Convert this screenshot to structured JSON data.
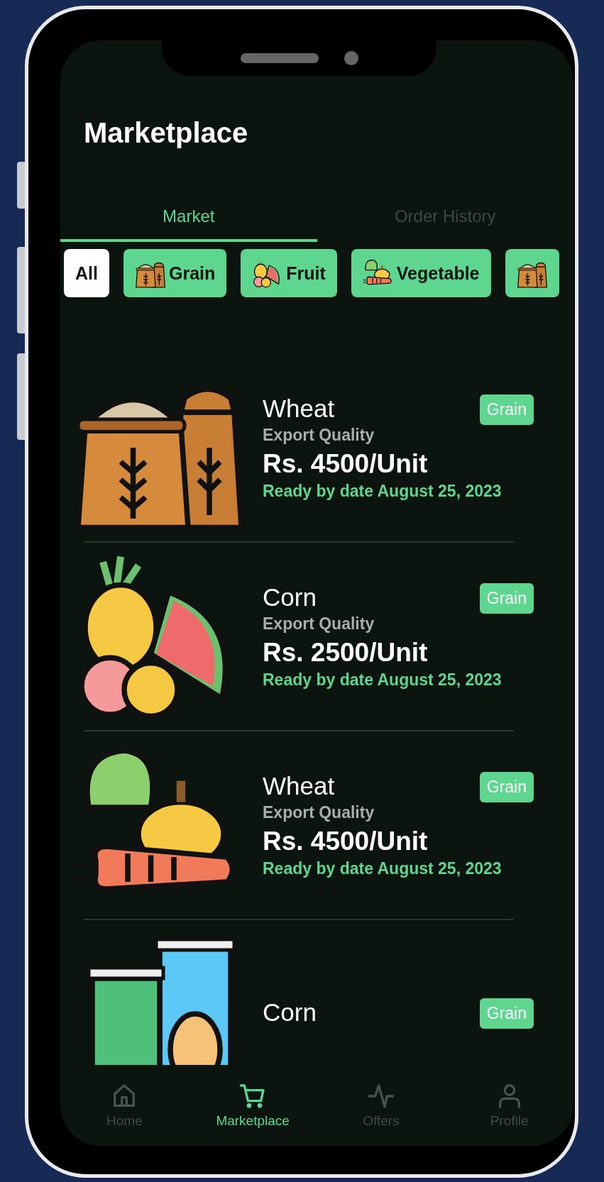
{
  "header": {
    "title": "Marketplace"
  },
  "tabs": [
    {
      "label": "Market",
      "selected": true
    },
    {
      "label": "Order History",
      "selected": false
    }
  ],
  "filters": [
    {
      "label": "All",
      "kind": "plain",
      "selected": true
    },
    {
      "label": "Grain",
      "kind": "grain",
      "selected": false
    },
    {
      "label": "Fruit",
      "kind": "fruit",
      "selected": false
    },
    {
      "label": "Vegetable",
      "kind": "vegetable",
      "selected": false
    },
    {
      "kind": "grain",
      "selected": false
    }
  ],
  "listings": [
    {
      "kind": "grain",
      "name": "Wheat",
      "quality": "Export Quality",
      "price": "Rs. 4500/Unit",
      "ready": "Ready by date August 25, 2023",
      "badge": "Grain"
    },
    {
      "kind": "fruit",
      "name": "Corn",
      "quality": "Export Quality",
      "price": "Rs. 2500/Unit",
      "ready": "Ready by date August 25, 2023",
      "badge": "Grain"
    },
    {
      "kind": "vegetable",
      "name": "Wheat",
      "quality": "Export Quality",
      "price": "Rs. 4500/Unit",
      "ready": "Ready by date August 25, 2023",
      "badge": "Grain"
    },
    {
      "kind": "jars",
      "name": "Corn",
      "badge": "Grain"
    }
  ],
  "bottom_nav": [
    {
      "kind": "home",
      "label": "Home",
      "selected": false
    },
    {
      "kind": "cart",
      "label": "Marketplace",
      "selected": true
    },
    {
      "kind": "pulse",
      "label": "Offers",
      "selected": false
    },
    {
      "kind": "user",
      "label": "Profile",
      "selected": false
    }
  ]
}
